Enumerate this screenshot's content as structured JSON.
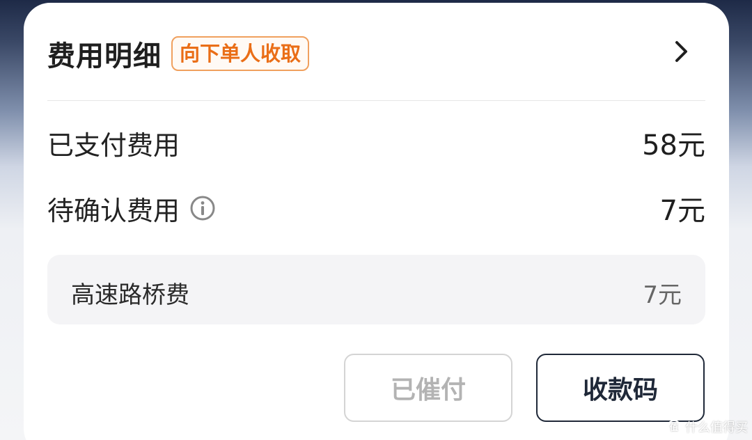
{
  "header": {
    "title": "费用明细",
    "tag": "向下单人收取",
    "chevron_icon": "chevron-right-icon"
  },
  "fees": {
    "paid": {
      "label": "已支付费用",
      "value": "58元"
    },
    "pending": {
      "label": "待确认费用",
      "value": "7元",
      "info_icon": "info-icon"
    },
    "items": [
      {
        "label": "高速路桥费",
        "value": "7元"
      }
    ]
  },
  "actions": {
    "urged_label": "已催付",
    "qrcode_label": "收款码"
  },
  "watermark": {
    "logo": "值",
    "text": "什么值得买"
  },
  "colors": {
    "tag_border": "#f0a05e",
    "tag_text": "#ea6e17",
    "primary_button": "#1f2838",
    "disabled_button": "#b3b3b3"
  }
}
